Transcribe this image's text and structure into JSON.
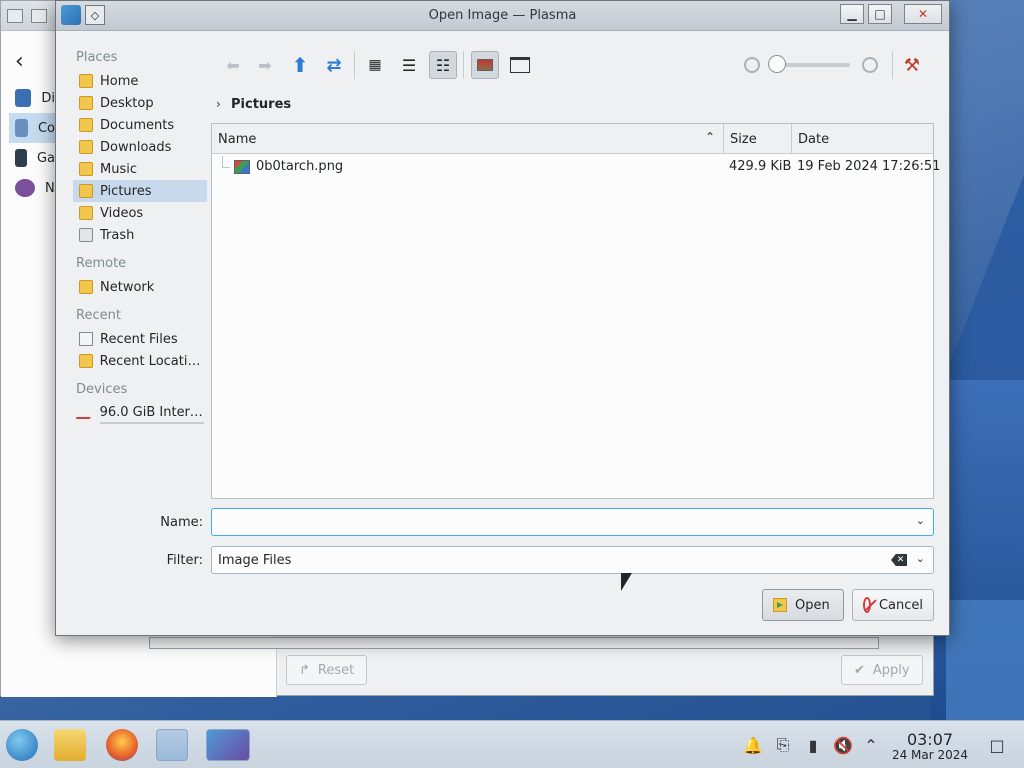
{
  "dialog": {
    "title": "Open Image — Plasma"
  },
  "places": {
    "sections": [
      "Places",
      "Remote",
      "Recent",
      "Devices"
    ],
    "items": [
      {
        "label": "Home",
        "icon": "home-folder-icon"
      },
      {
        "label": "Desktop",
        "icon": "desktop-folder-icon"
      },
      {
        "label": "Documents",
        "icon": "documents-folder-icon"
      },
      {
        "label": "Downloads",
        "icon": "downloads-folder-icon"
      },
      {
        "label": "Music",
        "icon": "music-folder-icon"
      },
      {
        "label": "Pictures",
        "icon": "pictures-folder-icon",
        "selected": true
      },
      {
        "label": "Videos",
        "icon": "videos-folder-icon"
      },
      {
        "label": "Trash",
        "icon": "trash-icon"
      },
      {
        "label": "Network",
        "icon": "network-icon"
      },
      {
        "label": "Recent Files",
        "icon": "recent-files-icon"
      },
      {
        "label": "Recent Locations",
        "icon": "recent-locations-icon"
      },
      {
        "label": "96.0 GiB Intern...",
        "icon": "drive-icon"
      }
    ]
  },
  "breadcrumb": {
    "current": "Pictures"
  },
  "fileview": {
    "columns": [
      "Name",
      "Size",
      "Date"
    ],
    "rows": [
      {
        "name": "0b0tarch.png",
        "size": "429.9 KiB",
        "date": "19 Feb 2024 17:26:51"
      }
    ]
  },
  "fields": {
    "name_label": "Name:",
    "name_value": "",
    "filter_label": "Filter:",
    "filter_value": "Image Files"
  },
  "buttons": {
    "open": "Open",
    "cancel": "Cancel"
  },
  "background_window": {
    "sidebar_items": [
      "Di",
      "Co",
      "Ga",
      "N"
    ],
    "reset": "Reset",
    "apply": "Apply"
  },
  "taskbar": {
    "time": "03:07",
    "date": "24 Mar 2024"
  },
  "colors": {
    "accent": "#3daee9",
    "selection": "#c7d9ea"
  }
}
